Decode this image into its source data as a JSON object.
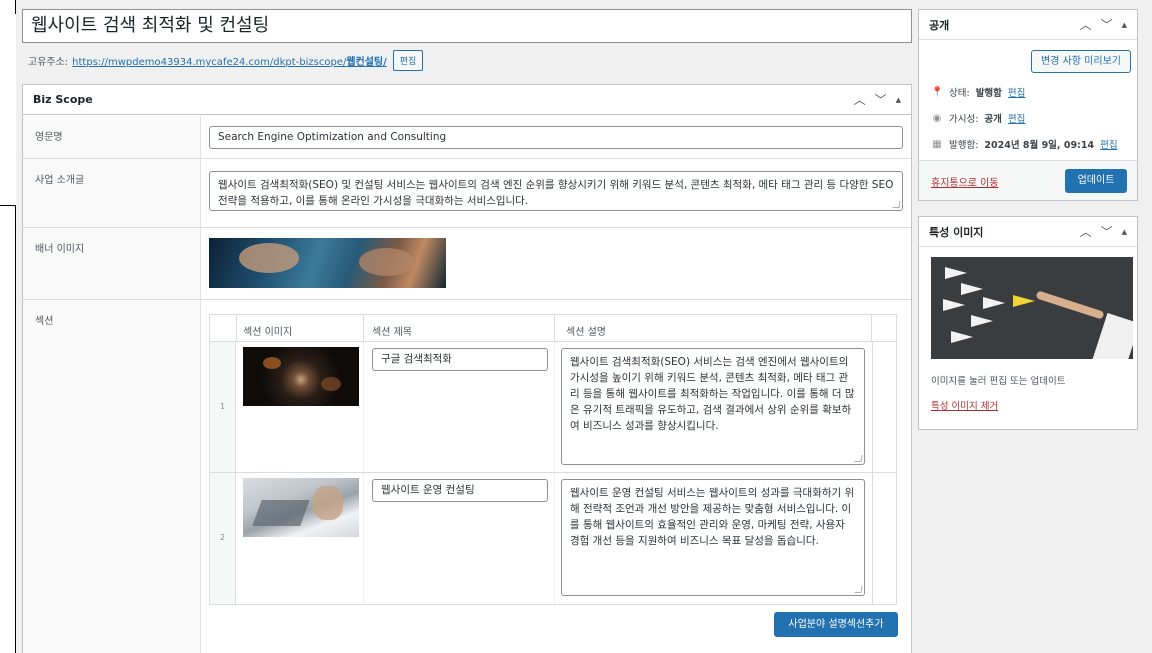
{
  "post": {
    "title": "웹사이트 검색 최적화 및 컨설팅",
    "permalink_label": "고유주소:",
    "permalink_base": "https://mwpdemo43934.mycafe24.com/dkpt-bizscope/",
    "permalink_slug": "웹컨설팅/",
    "permalink_edit": "편집"
  },
  "biz_scope": {
    "title": "Biz Scope",
    "fields": {
      "english_name_label": "영문명",
      "english_name_value": "Search Engine Optimization and Consulting",
      "intro_label": "사업 소개글",
      "intro_value": "웹사이트 검색최적화(SEO) 및 컨설팅 서비스는 웹사이트의 검색 엔진 순위를 향상시키기 위해 키워드 분석, 콘텐츠 최적화, 메타 태그 관리 등 다양한 SEO 전략을 적용하고, 이를 통해 온라인 가시성을 극대화하는 서비스입니다.",
      "banner_label": "배너 이미지",
      "section_label": "섹션"
    },
    "section_table": {
      "headers": [
        "섹션 이미지",
        "섹션 제목",
        "섹션 설명"
      ],
      "rows": [
        {
          "index": "1",
          "title": "구글 검색최적화",
          "description": "웹사이트 검색최적화(SEO) 서비스는 검색 엔진에서 웹사이트의 가시성을 높이기 위해 키워드 분석, 콘텐츠 최적화, 메타 태그 관리 등을 통해 웹사이트를 최적화하는 작업입니다. 이를 통해 더 많은 유기적 트래픽을 유도하고, 검색 결과에서 상위 순위를 확보하여 비즈니스 성과를 향상시킵니다."
        },
        {
          "index": "2",
          "title": "웹사이트 운영 컨설팅",
          "description": "웹사이트 운영 컨설팅 서비스는 웹사이트의 성과를 극대화하기 위해 전략적 조언과 개선 방안을 제공하는 맞춤형 서비스입니다. 이를 통해 웹사이트의 효율적인 관리와 운영, 마케팅 전략, 사용자 경험 개선 등을 지원하여 비즈니스 목표 달성을 돕습니다."
        }
      ],
      "add_button": "사업분야 설명섹션추가"
    }
  },
  "publish": {
    "title": "공개",
    "preview_button": "변경 사항 미리보기",
    "status_label": "상태:",
    "status_value": "발행함",
    "visibility_label": "가시성:",
    "visibility_value": "공개",
    "published_label": "발행함:",
    "published_value": "2024년 8월 9일, 09:14",
    "edit_link": "편집",
    "trash_link": "휴지통으로 이동",
    "update_button": "업데이트"
  },
  "featured_image": {
    "title": "특성 이미지",
    "caption": "이미지를 눌러 편집 또는 업데이트",
    "remove_link": "특성 이미지 제거"
  },
  "icons": {
    "status": "pin-icon",
    "visibility": "eye-icon",
    "published": "calendar-icon"
  },
  "colors": {
    "primary": "#2271b1",
    "danger": "#b32d2e",
    "background": "#f0f0f1"
  }
}
